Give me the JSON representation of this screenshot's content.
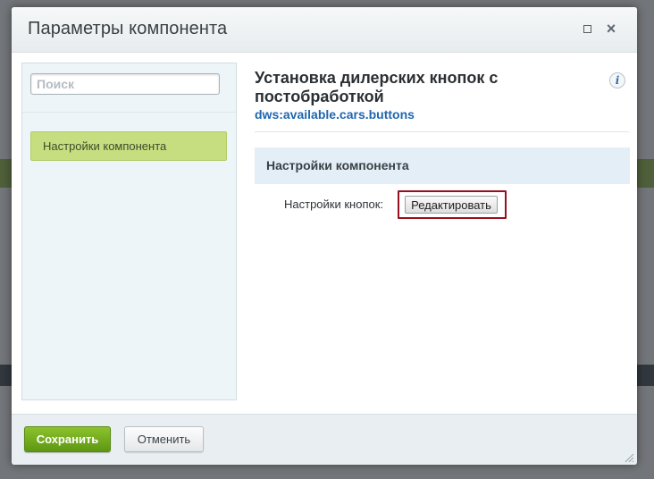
{
  "dialog": {
    "title": "Параметры компонента",
    "maximize_icon": "maximize-icon",
    "close_icon": "close-icon"
  },
  "sidebar": {
    "search": {
      "placeholder": "Поиск",
      "value": ""
    },
    "items": [
      {
        "label": "Настройки компонента",
        "active": true
      }
    ]
  },
  "main": {
    "title": "Установка дилерских кнопок с постобработкой",
    "code": "dws:available.cars.buttons",
    "info_icon": "info-icon",
    "section": {
      "title": "Настройки компонента",
      "params": [
        {
          "label": "Настройки кнопок:",
          "button": "Редактировать"
        }
      ]
    }
  },
  "footer": {
    "save_label": "Сохранить",
    "cancel_label": "Отменить"
  },
  "colors": {
    "accent_green": "#7ab320",
    "active_item": "#c6de7f",
    "link_blue": "#2067b0",
    "highlight_red": "#96101d",
    "section_bg": "#e3eef6"
  }
}
